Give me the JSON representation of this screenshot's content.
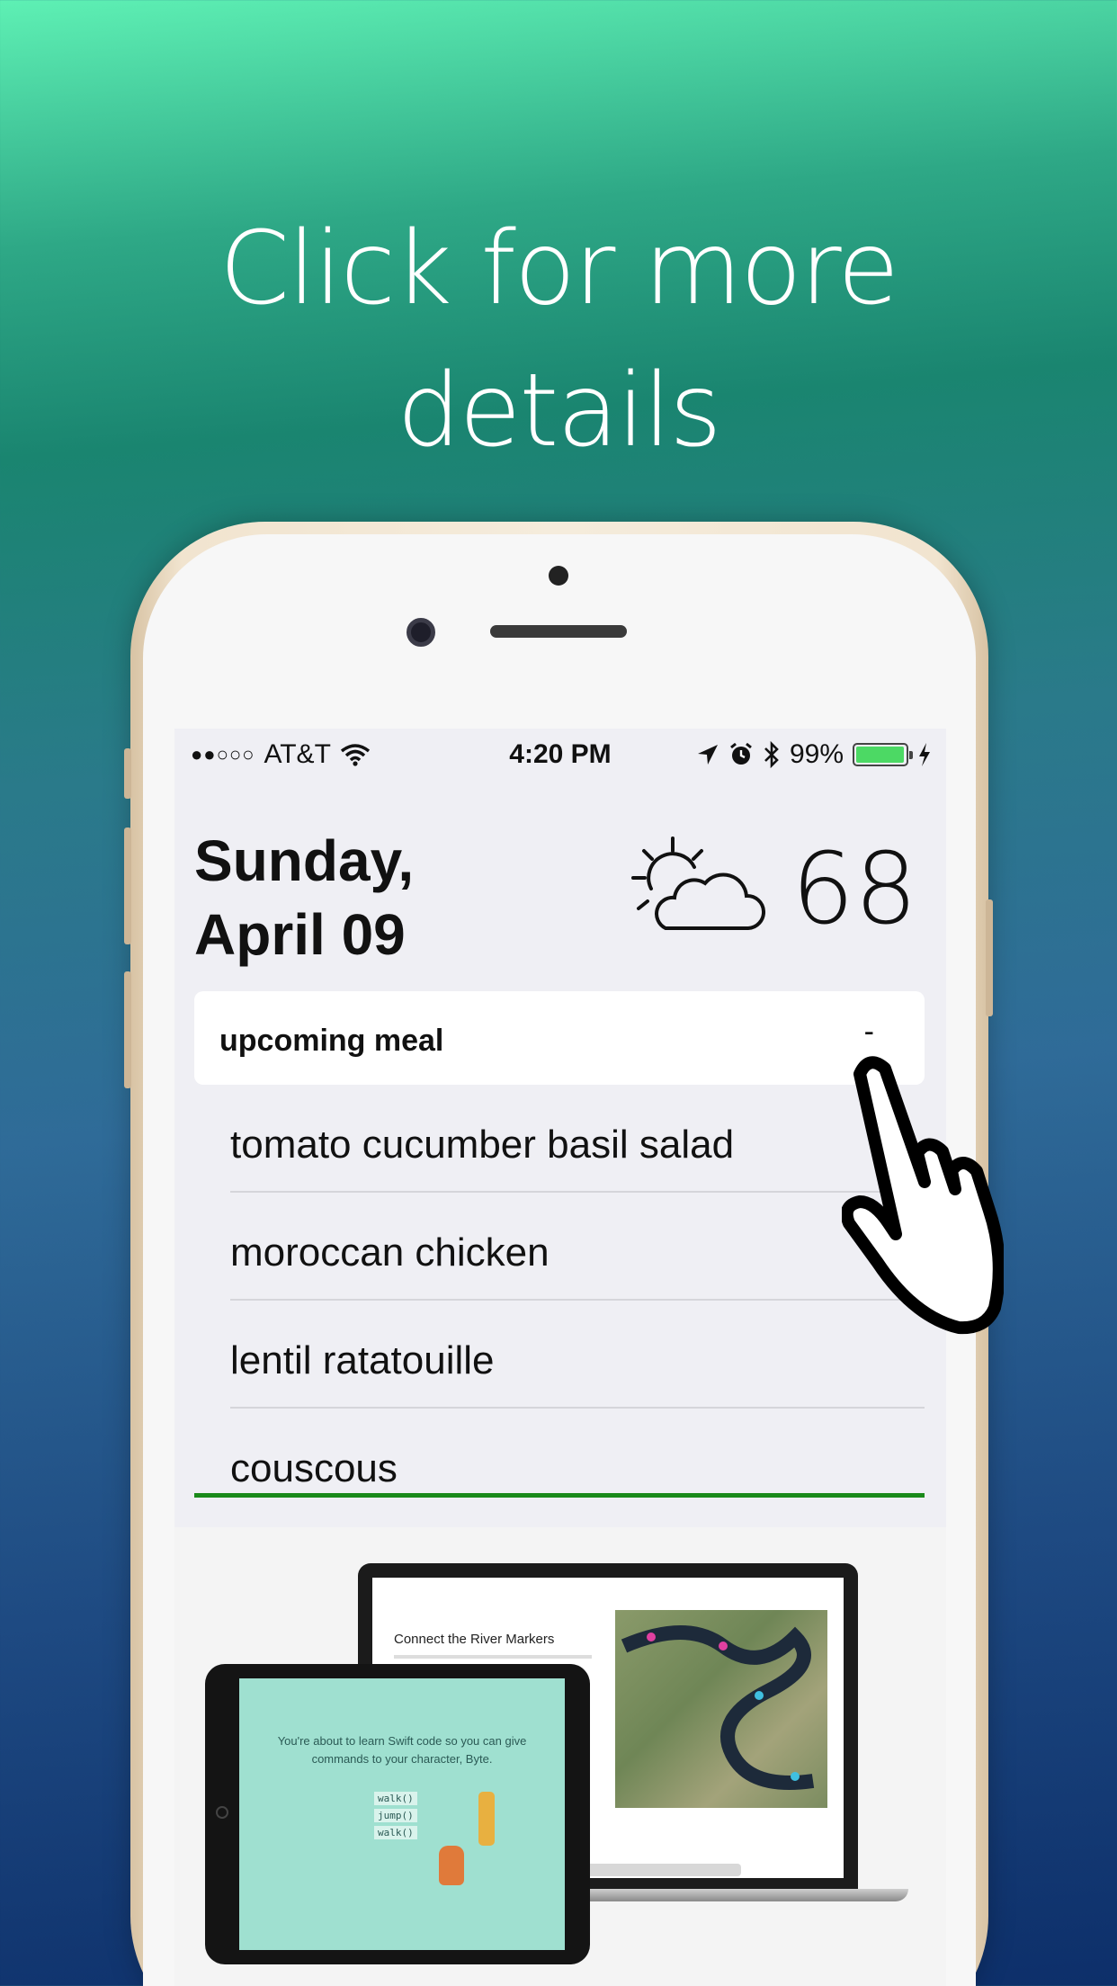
{
  "headline": {
    "line1": "Click for more",
    "line2": "details"
  },
  "status_bar": {
    "signal": "●●○○○",
    "carrier": "AT&T",
    "time": "4:20 PM",
    "battery_percent": "99%",
    "battery_level": 0.99,
    "icons": [
      "wifi-icon",
      "location-arrow-icon",
      "alarm-icon",
      "bluetooth-icon",
      "battery-icon",
      "charging-bolt-icon"
    ]
  },
  "header": {
    "date_line1": "Sunday,",
    "date_line2": "April 09",
    "weather_icon": "partly-sunny-icon",
    "temperature": "68"
  },
  "meal_section": {
    "title": "upcoming meal",
    "toggle_label": "-",
    "items": [
      "tomato cucumber basil salad",
      "moroccan chicken",
      "lentil ratatouille",
      "couscous"
    ]
  },
  "promo": {
    "laptop_title": "Connect the River Markers",
    "tablet_text": "You're about to learn Swift code so you can give commands to your character, Byte.",
    "code_lines": [
      "walk()",
      "jump()",
      "walk()"
    ]
  },
  "colors": {
    "accent_green": "#1a8a1a",
    "battery_green": "#4cd964",
    "screen_bg": "#efeff4"
  }
}
